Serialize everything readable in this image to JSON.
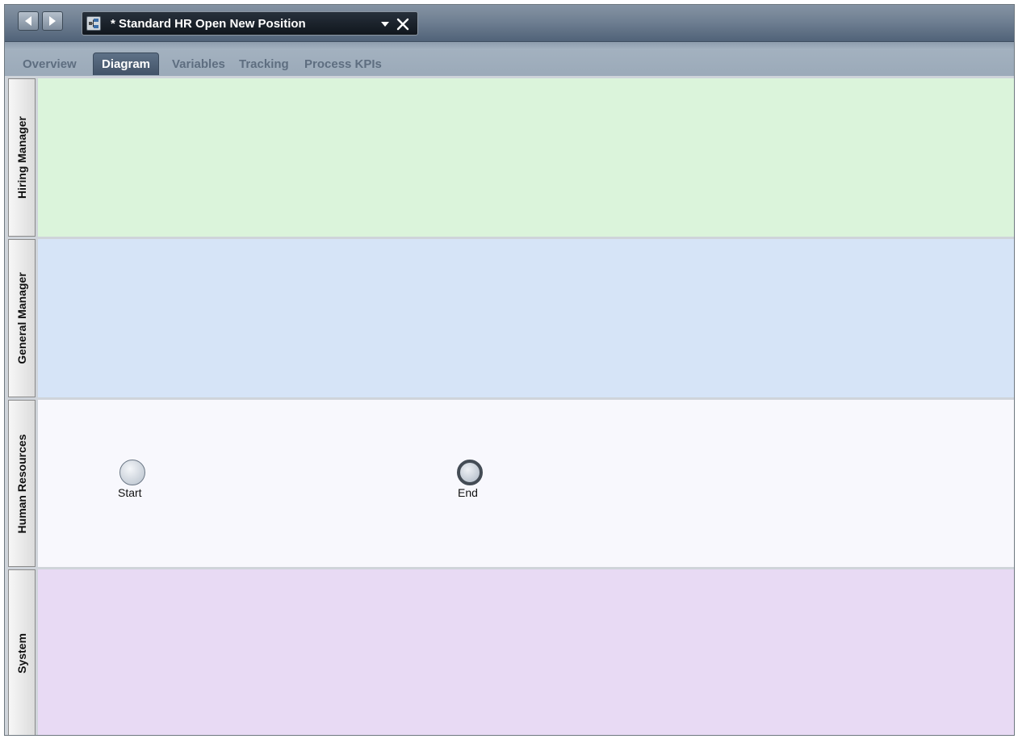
{
  "document": {
    "title": "* Standard HR Open New Position",
    "back_icon": "back-arrow-icon",
    "forward_icon": "forward-arrow-icon",
    "process_icon": "process-diagram-icon",
    "dropdown_icon": "chevron-down-icon",
    "close_icon": "close-icon"
  },
  "tabs": [
    {
      "label": "Overview",
      "active": false
    },
    {
      "label": "Diagram",
      "active": true
    },
    {
      "label": "Variables",
      "active": false
    },
    {
      "label": "Tracking",
      "active": false
    },
    {
      "label": "Process KPIs",
      "active": false
    }
  ],
  "lanes": [
    {
      "label": "Hiring Manager",
      "color": "#dbf4db"
    },
    {
      "label": "General Manager",
      "color": "#d6e4f7"
    },
    {
      "label": "Human Resources",
      "color": "#f8f8fd"
    },
    {
      "label": "System",
      "color": "#e8daf4"
    }
  ],
  "events": {
    "start": {
      "label": "Start",
      "type": "start-event"
    },
    "end": {
      "label": "End",
      "type": "end-event"
    }
  }
}
